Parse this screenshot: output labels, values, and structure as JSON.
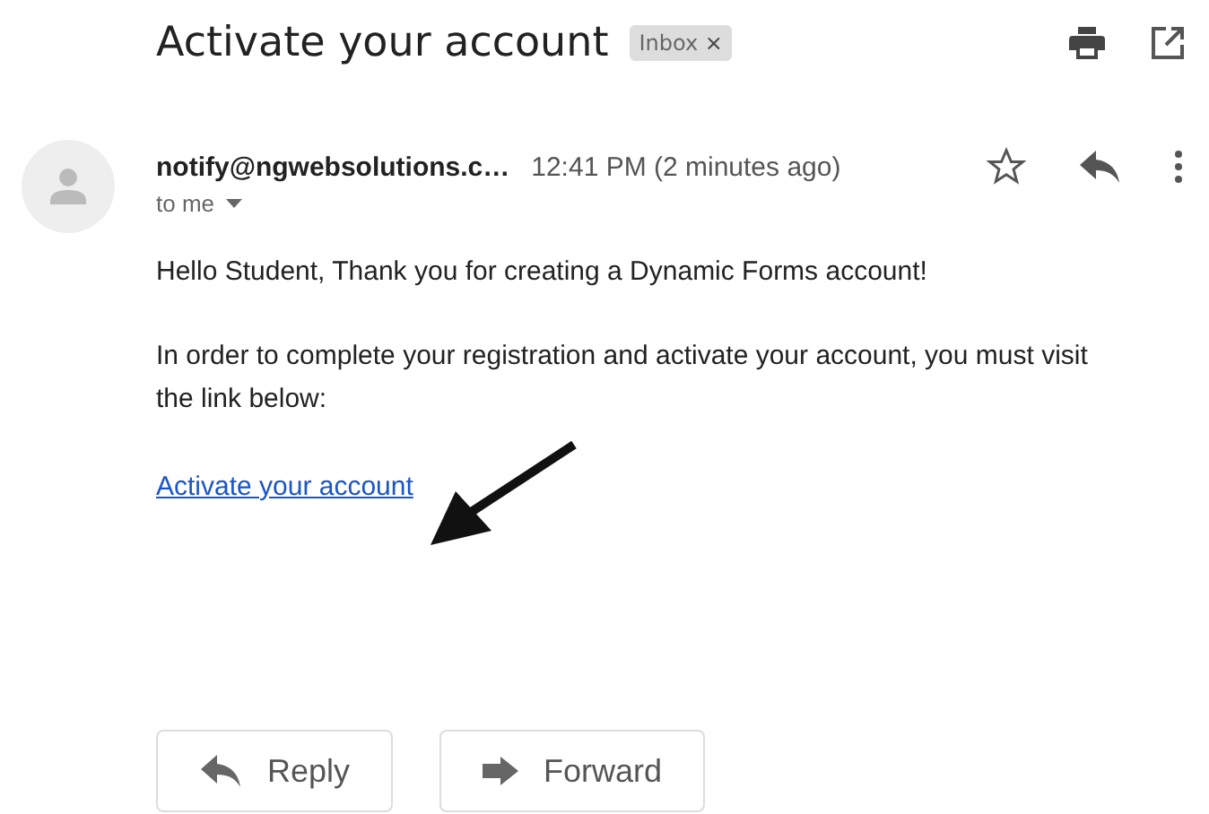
{
  "subject": "Activate your account",
  "label": {
    "text": "Inbox",
    "remove": "×"
  },
  "sender": "notify@ngwebsolutions.c…",
  "time": "12:41 PM (2 minutes ago)",
  "recipient": "to me",
  "body": [
    "Hello Student, Thank you for creating a Dynamic Forms account!",
    "In order to complete your registration and activate your account, you must visit the link below:"
  ],
  "link": "Activate your account",
  "buttons": [
    {
      "kind": "reply",
      "label": "Reply"
    },
    {
      "kind": "forward",
      "label": "Forward"
    }
  ]
}
